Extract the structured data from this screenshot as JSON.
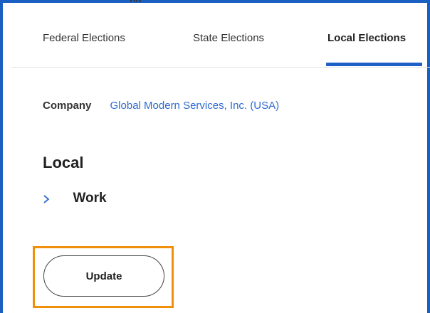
{
  "header_fragment": "ng",
  "tabs": [
    {
      "label": "Federal Elections"
    },
    {
      "label": "State Elections"
    },
    {
      "label": "Local Elections"
    }
  ],
  "company": {
    "label": "Company",
    "value": "Global Modern Services, Inc. (USA)"
  },
  "section": {
    "heading": "Local",
    "item_label": "Work"
  },
  "actions": {
    "update_label": "Update"
  },
  "colors": {
    "accent_blue": "#1f5fc8",
    "link_blue": "#2f6bd0",
    "highlight_orange": "#f0900a"
  }
}
